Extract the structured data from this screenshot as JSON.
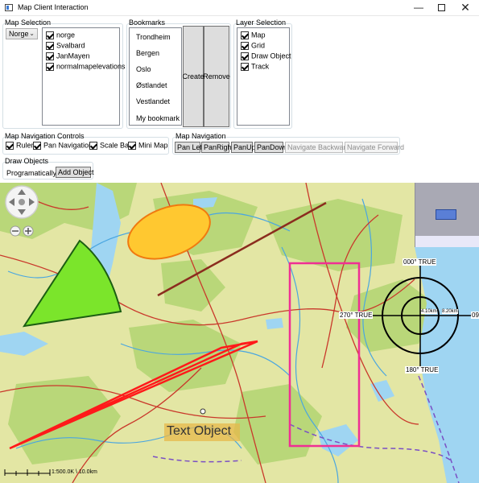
{
  "window": {
    "title": "Map Client Interaction",
    "min_glyph": "—",
    "close_glyph": "✕"
  },
  "map_selection": {
    "label": "Map Selection",
    "combo_value": "Norge",
    "items": [
      {
        "label": "norge",
        "checked": true
      },
      {
        "label": "Svalbard",
        "checked": true
      },
      {
        "label": "JanMayen",
        "checked": true
      },
      {
        "label": "normalmapelevations",
        "checked": true
      }
    ]
  },
  "bookmarks": {
    "label": "Bookmarks",
    "items": [
      "Trondheim",
      "Bergen",
      "Oslo",
      "Østlandet",
      "Vestlandet",
      "My bookmark"
    ],
    "create_label": "Create",
    "remove_label": "Remove"
  },
  "layer_selection": {
    "label": "Layer Selection",
    "items": [
      {
        "label": "Map",
        "checked": true
      },
      {
        "label": "Grid",
        "checked": true
      },
      {
        "label": "Draw Object",
        "checked": true
      },
      {
        "label": "Track",
        "checked": true
      }
    ]
  },
  "nav_controls": {
    "label": "Map Navigation Controls",
    "items": [
      {
        "label": "Ruler",
        "checked": true
      },
      {
        "label": "Pan Navigation",
        "checked": true
      },
      {
        "label": "Scale Bar",
        "checked": true
      },
      {
        "label": "Mini Map",
        "checked": true
      }
    ]
  },
  "map_navigation": {
    "label": "Map Navigation",
    "buttons": [
      {
        "label": "Pan Left",
        "enabled": true
      },
      {
        "label": "PanRight",
        "enabled": true
      },
      {
        "label": "PanUp",
        "enabled": true
      },
      {
        "label": "PanDown",
        "enabled": true
      },
      {
        "label": "Navigate Backward",
        "enabled": false
      },
      {
        "label": "Navigate Forward",
        "enabled": false
      }
    ]
  },
  "draw_objects": {
    "label": "Draw Objects",
    "programmatically_label": "Programatically:",
    "add_object_label": "Add Object"
  },
  "map": {
    "text_object": "Text Object",
    "bearing_labels": {
      "top": "000° TRUE",
      "left": "270° TRUE",
      "bottom": "180° TRUE",
      "right": "09"
    },
    "range_labels": [
      "4.10km",
      "8.20km"
    ],
    "scale_text": "1:500.0K \\ 10.0km",
    "colors": {
      "land": "#e3e6a4",
      "forest": "#b9d779",
      "water": "#9fd5f2",
      "road": "#c9382b",
      "sector_fill": "#7be52b",
      "ellipse_fill": "#ffc830",
      "ellipse_stroke": "#f07a10",
      "polyline": "#ff1a1a",
      "rect_stroke": "#ef2f94",
      "brown_line": "#8b2c1e"
    }
  }
}
